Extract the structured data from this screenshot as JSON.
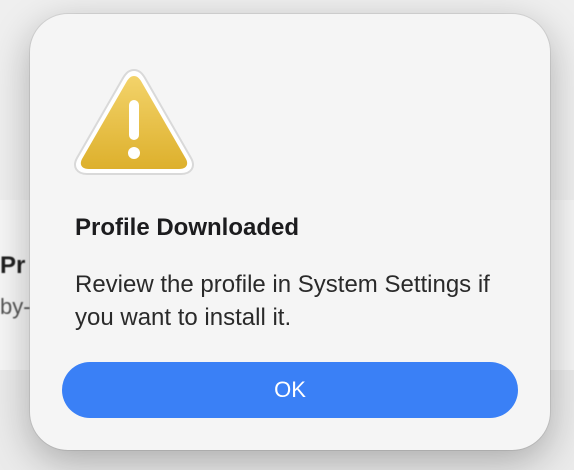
{
  "background": {
    "heading_fragment": "Pr",
    "subtext_fragment": "by-"
  },
  "dialog": {
    "icon": "warning-triangle-icon",
    "title": "Profile Downloaded",
    "message": "Review the profile in System Settings if you want to install it.",
    "ok_label": "OK",
    "accent_color": "#3a80f6",
    "icon_color": "#e7b93a"
  }
}
